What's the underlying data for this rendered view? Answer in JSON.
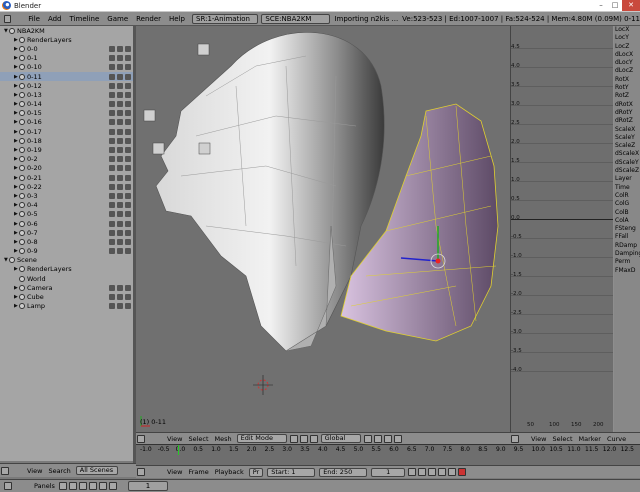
{
  "window": {
    "title": "Blender",
    "min": "–",
    "max": "□",
    "close": "✕"
  },
  "menubar": {
    "items": [
      "File",
      "Add",
      "Timeline",
      "Game",
      "Render",
      "Help"
    ],
    "screen": "SR:1-Animation",
    "scene": "SCE:NBA2KM",
    "status": "Importing n2kis ...",
    "stats": "Ve:523-523 | Ed:1007-1007 | Fa:524-524 | Mem:4.80M (0.09M) 0-11"
  },
  "outliner": {
    "rows": [
      {
        "label": "NBA2KM",
        "indent": 0,
        "tri": "▼"
      },
      {
        "label": "RenderLayers",
        "indent": 1,
        "tri": "▶"
      },
      {
        "label": "0-0",
        "indent": 1,
        "tri": "▶"
      },
      {
        "label": "0-1",
        "indent": 1,
        "tri": "▶"
      },
      {
        "label": "0-10",
        "indent": 1,
        "tri": "▶"
      },
      {
        "label": "0-11",
        "indent": 1,
        "tri": "▶",
        "sel": true
      },
      {
        "label": "0-12",
        "indent": 1,
        "tri": "▶"
      },
      {
        "label": "0-13",
        "indent": 1,
        "tri": "▶"
      },
      {
        "label": "0-14",
        "indent": 1,
        "tri": "▶"
      },
      {
        "label": "0-15",
        "indent": 1,
        "tri": "▶"
      },
      {
        "label": "0-16",
        "indent": 1,
        "tri": "▶"
      },
      {
        "label": "0-17",
        "indent": 1,
        "tri": "▶"
      },
      {
        "label": "0-18",
        "indent": 1,
        "tri": "▶"
      },
      {
        "label": "0-19",
        "indent": 1,
        "tri": "▶"
      },
      {
        "label": "0-2",
        "indent": 1,
        "tri": "▶"
      },
      {
        "label": "0-20",
        "indent": 1,
        "tri": "▶"
      },
      {
        "label": "0-21",
        "indent": 1,
        "tri": "▶"
      },
      {
        "label": "0-22",
        "indent": 1,
        "tri": "▶"
      },
      {
        "label": "0-3",
        "indent": 1,
        "tri": "▶"
      },
      {
        "label": "0-4",
        "indent": 1,
        "tri": "▶"
      },
      {
        "label": "0-5",
        "indent": 1,
        "tri": "▶"
      },
      {
        "label": "0-6",
        "indent": 1,
        "tri": "▶"
      },
      {
        "label": "0-7",
        "indent": 1,
        "tri": "▶"
      },
      {
        "label": "0-8",
        "indent": 1,
        "tri": "▶"
      },
      {
        "label": "0-9",
        "indent": 1,
        "tri": "▶"
      },
      {
        "label": "Scene",
        "indent": 0,
        "tri": "▼"
      },
      {
        "label": "RenderLayers",
        "indent": 1,
        "tri": "▶"
      },
      {
        "label": "World",
        "indent": 1,
        "tri": ""
      },
      {
        "label": "Camera",
        "indent": 1,
        "tri": "▶"
      },
      {
        "label": "Cube",
        "indent": 1,
        "tri": "▶"
      },
      {
        "label": "Lamp",
        "indent": 1,
        "tri": "▶"
      }
    ]
  },
  "viewport": {
    "info": "(1) 0-11"
  },
  "ipo": {
    "channels": [
      "LocX",
      "LocY",
      "LocZ",
      "dLocX",
      "dLocY",
      "dLocZ",
      "RotX",
      "RotY",
      "RotZ",
      "dRotX",
      "dRotY",
      "dRotZ",
      "ScaleX",
      "ScaleY",
      "ScaleZ",
      "dScaleX",
      "dScaleY",
      "dScaleZ",
      "Layer",
      "Time",
      "ColR",
      "ColG",
      "ColB",
      "ColA",
      "FSteng",
      "FFall",
      "RDamp",
      "Damping",
      "Perm",
      "FMaxD"
    ],
    "yticks": [
      "4.5",
      "4.0",
      "3.5",
      "3.0",
      "2.5",
      "2.0",
      "1.5",
      "1.0",
      "0.5",
      "0.0",
      "-0.5",
      "-1.0",
      "-1.5",
      "-2.0",
      "-2.5",
      "-3.0",
      "-3.5",
      "-4.0"
    ],
    "xticks": [
      "50",
      "100",
      "150",
      "200"
    ]
  },
  "view3d_header": {
    "view": "View",
    "select": "Select",
    "object": "Mesh",
    "mode": "Edit Mode",
    "orient": "Global"
  },
  "ipo_header": {
    "view": "View",
    "select": "Select",
    "marker": "Marker",
    "curve": "Curve"
  },
  "timeline": {
    "ticks": [
      "-1.0",
      "-0.5",
      "0.0",
      "0.5",
      "1.0",
      "1.5",
      "2.0",
      "2.5",
      "3.0",
      "3.5",
      "4.0",
      "4.5",
      "5.0",
      "5.5",
      "6.0",
      "6.5",
      "7.0",
      "7.5",
      "8.0",
      "8.5",
      "9.0",
      "9.5",
      "10.0",
      "10.5",
      "11.0",
      "11.5",
      "12.0",
      "12.5"
    ],
    "view": "View",
    "frame": "Frame",
    "playback": "Playback",
    "pr": "Pr",
    "start": "Start: 1",
    "end": "End: 250",
    "current": "1"
  },
  "outliner_header": {
    "view": "View",
    "search": "Search",
    "scenes": "All Scenes"
  },
  "statusbar": {
    "panels": "Panels",
    "page": "1"
  }
}
